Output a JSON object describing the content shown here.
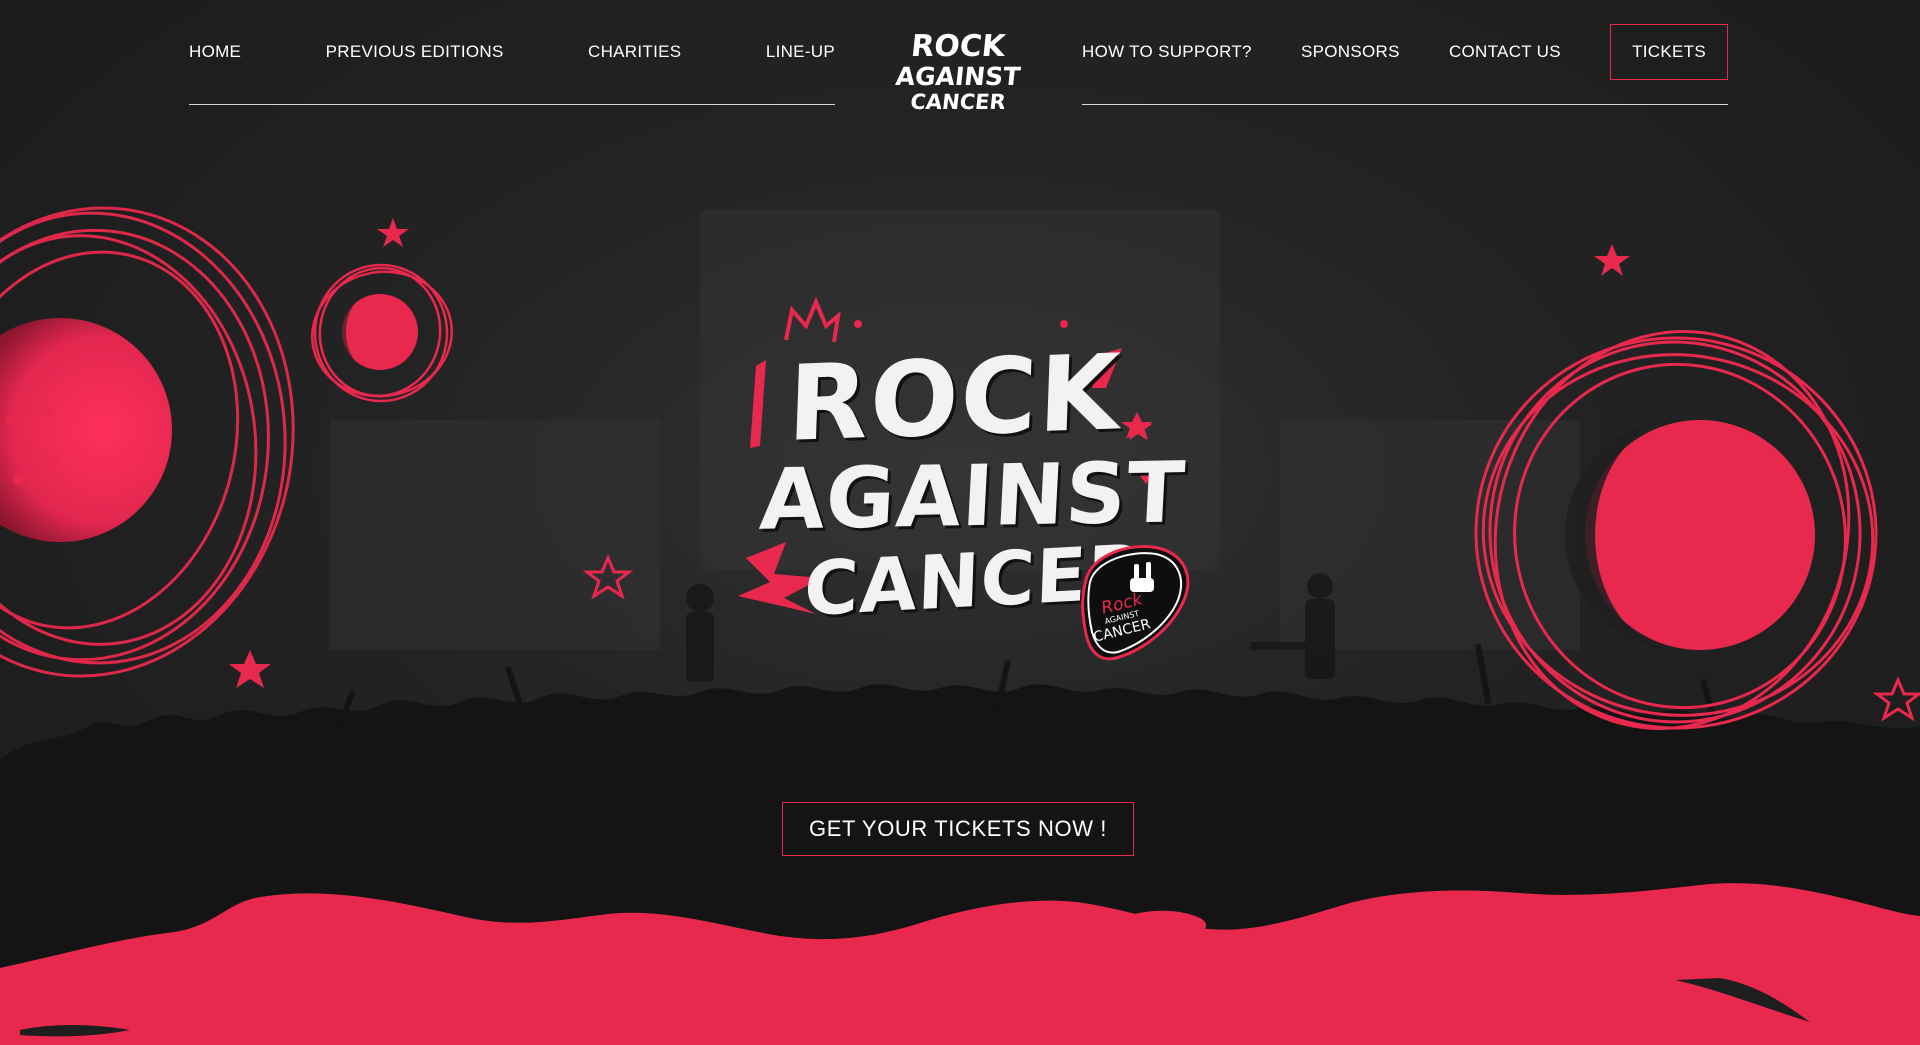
{
  "nav": {
    "left_items": [
      {
        "label": "HOME"
      },
      {
        "label": "PREVIOUS EDITIONS"
      },
      {
        "label": "CHARITIES"
      },
      {
        "label": "LINE-UP"
      }
    ],
    "right_items": [
      {
        "label": "HOW TO SUPPORT?"
      },
      {
        "label": "SPONSORS"
      },
      {
        "label": "CONTACT US"
      }
    ],
    "tickets_label": "TICKETS",
    "logo": {
      "line1": "ROCK",
      "line2": "AGAINST",
      "line3": "CANCER"
    }
  },
  "hero": {
    "logo": {
      "line1": "ROCK",
      "line2": "AGAINST",
      "line3": "CANCER"
    },
    "pick": {
      "line1": "Rock",
      "line2": "AGAINST",
      "line3": "CANCER"
    },
    "cta_label": "GET YOUR TICKETS NOW !"
  },
  "colors": {
    "accent": "#e8294d",
    "background": "#232323",
    "text": "#ffffff"
  },
  "icons": {
    "stars": "star-icon",
    "moons": "moon-icon",
    "pick": "guitar-pick-icon",
    "rock_hand": "rock-hand-icon",
    "lightning": "lightning-bolt-icon",
    "crown": "crown-icon"
  }
}
